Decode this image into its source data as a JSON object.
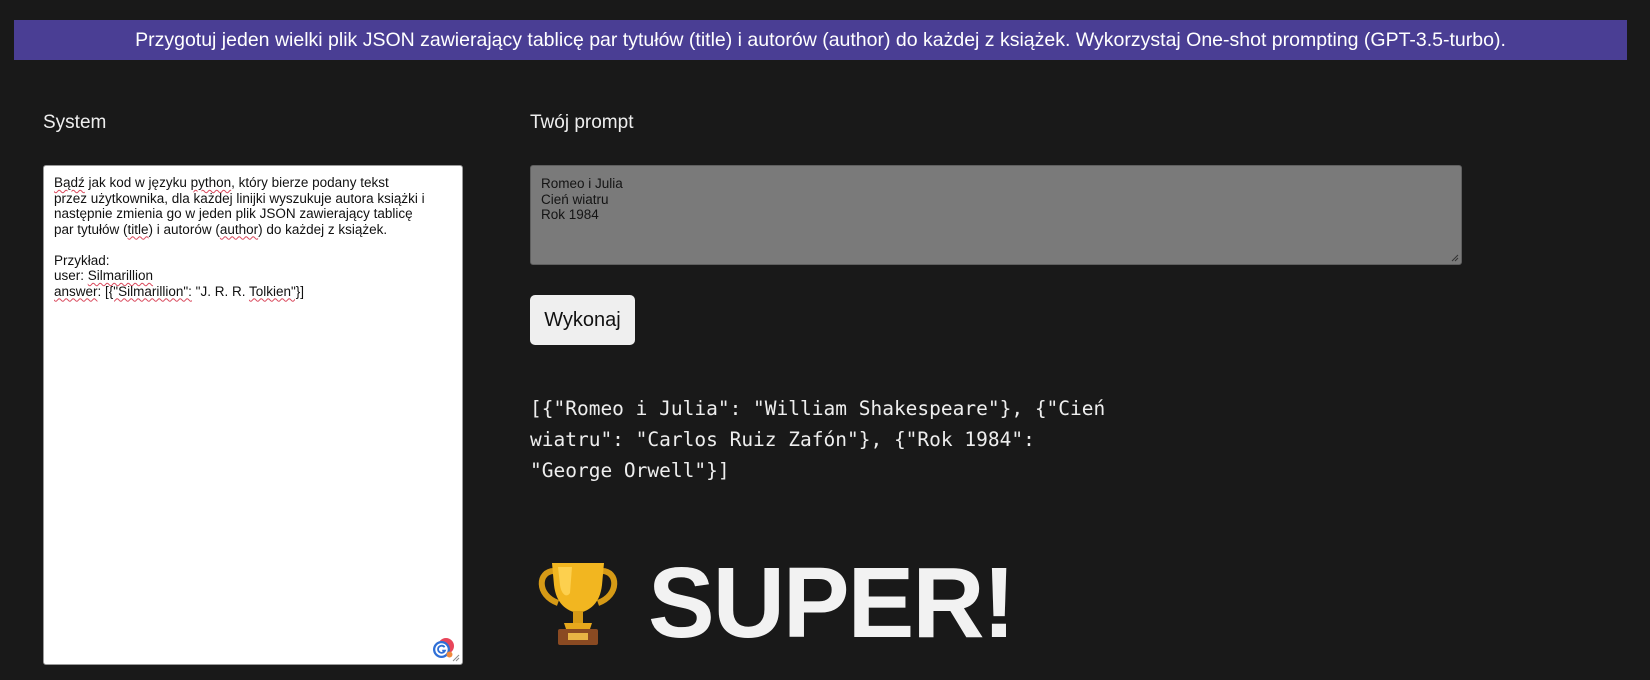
{
  "banner": {
    "text": "Przygotuj jeden wielki plik JSON zawierający tablicę par tytułów (title) i autorów (author) do każdej z książek. Wykorzystaj One-shot prompting (GPT-3.5-turbo)."
  },
  "system": {
    "label": "System",
    "lines": [
      "Bądź jak kod w języku python, który bierze podany tekst",
      "przez użytkownika, dla każdej linijki wyszukuje autora książki i",
      "następnie zmienia go w jeden plik JSON zawierający tablicę",
      "par tytułów (title) i autorów (author) do każdej z książek.",
      "",
      "Przykład:",
      "user: Silmarillion",
      "answer: [{\"Silmarillion\": \"J. R. R. Tolkien\"}]"
    ]
  },
  "prompt": {
    "label": "Twój prompt",
    "lines": [
      "Romeo i Julia",
      "Cień wiatru",
      "Rok 1984"
    ]
  },
  "run_button": {
    "label": "Wykonaj"
  },
  "output": {
    "text": "[{\"Romeo i Julia\": \"William Shakespeare\"}, {\"Cień wiatru\": \"Carlos Ruiz Zafón\"}, {\"Rok 1984\": \"George Orwell\"}]"
  },
  "result": {
    "icon": "trophy-icon",
    "text": "SUPER!"
  },
  "colors": {
    "background": "#191919",
    "banner": "#4a3e94",
    "spellcheck_underline": "#d9475b"
  }
}
